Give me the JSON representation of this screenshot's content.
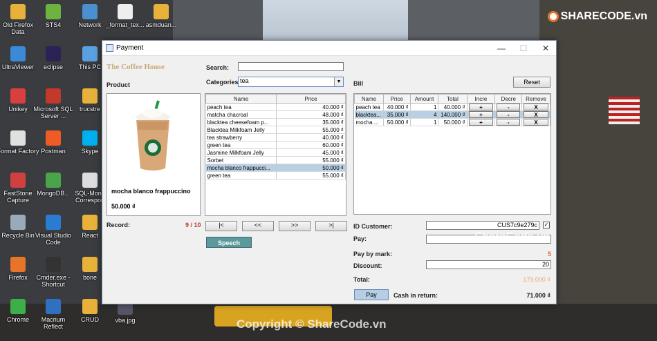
{
  "desktop": {
    "icons_left": [
      {
        "label": "Old Firefox Data",
        "color": "#e8b23a"
      },
      {
        "label": "UltraViewer",
        "color": "#3a8ad8"
      },
      {
        "label": "Unikey",
        "color": "#d84040"
      },
      {
        "label": "Format Factory",
        "color": "#e0e0e0"
      },
      {
        "label": "FastStone Capture",
        "color": "#d04040"
      },
      {
        "label": "Recycle Bin",
        "color": "#9ab"
      },
      {
        "label": "Firefox",
        "color": "#e8742a"
      },
      {
        "label": "Chrome",
        "color": "#3cae4a"
      }
    ],
    "icons_col2": [
      {
        "label": "STS4",
        "color": "#6cb33f"
      },
      {
        "label": "eclipse",
        "color": "#2c2255"
      },
      {
        "label": "Microsoft SQL Server ...",
        "color": "#c0392b"
      },
      {
        "label": "Postman",
        "color": "#ef5b25"
      },
      {
        "label": "MongoDB...",
        "color": "#4aa54a"
      },
      {
        "label": "Visual Studio Code",
        "color": "#2a7cd3"
      },
      {
        "label": "Cmder.exe - Shortcut",
        "color": "#333"
      },
      {
        "label": "Macrium Reflect",
        "color": "#3070c0"
      }
    ],
    "icons_col3": [
      {
        "label": "Network",
        "color": "#4a90d0"
      },
      {
        "label": "This PC",
        "color": "#5aa0e0"
      },
      {
        "label": "trucstre",
        "color": "#e8b23a"
      },
      {
        "label": "Skype",
        "color": "#00aff0"
      },
      {
        "label": "SQL-Mong Correspon",
        "color": "#ddd"
      },
      {
        "label": "React",
        "color": "#e8b23a"
      },
      {
        "label": "bone",
        "color": "#e8b23a"
      },
      {
        "label": "CRUD",
        "color": "#e8b23a"
      }
    ],
    "icons_col4": [
      {
        "label": "_format_tex...",
        "color": "#eee"
      },
      {
        "label": "vba.jpg",
        "color": "#556"
      }
    ],
    "icons_col5": [
      {
        "label": "asmduan...",
        "color": "#e8b23a"
      }
    ],
    "watermark_logo": "SHARECODE.vn",
    "watermark_mid": "ShareCode.vn",
    "watermark_bottom": "Copyright © ShareCode.vn"
  },
  "window": {
    "title": "Payment",
    "minimize": "—",
    "maximize": "☐",
    "close": "✕"
  },
  "app": {
    "shop_name": "The Coffee House",
    "product_label": "Product",
    "search_label": "Search:",
    "search_value": "",
    "categories_label": "Categories:",
    "categories_value": "tea",
    "product_name": "mocha blanco frappuccino",
    "product_price": "50.000 ₫",
    "record_label": "Record:",
    "record_value": "9 / 10",
    "nav": {
      "first": "|<",
      "prev": "<<",
      "next": ">>",
      "last": ">|"
    },
    "speech": "Speech",
    "product_table": {
      "headers": [
        "Name",
        "Price"
      ],
      "rows": [
        [
          "peach tea",
          "40.000 ₫"
        ],
        [
          "matcha chacroal",
          "48.000 ₫"
        ],
        [
          "blacktea cheesefoam p...",
          "35.000 ₫"
        ],
        [
          "Blacktea Milkfoam Jelly",
          "55.000 ₫"
        ],
        [
          "tea strawberry",
          "40.000 ₫"
        ],
        [
          "green tea",
          "60.000 ₫"
        ],
        [
          "Jasmine Milkfoam Jelly",
          "45.000 ₫"
        ],
        [
          "Sorbet",
          "55.000 ₫"
        ],
        [
          "mocha blanco frappucci...",
          "50.000 ₫"
        ],
        [
          "green tea",
          "55.000 ₫"
        ]
      ],
      "selected_index": 8
    },
    "bill_label": "Bill",
    "reset": "Reset",
    "bill_table": {
      "headers": [
        "Name",
        "Price",
        "Amount",
        "Total",
        "Incre",
        "Decre",
        "Remove"
      ],
      "rows": [
        {
          "name": "peach tea",
          "price": "40.000 ₫",
          "amount": "1",
          "total": "40.000 ₫",
          "incre": "+",
          "decre": "-",
          "remove": "X"
        },
        {
          "name": "blacktea...",
          "price": "35.000 ₫",
          "amount": "4",
          "total": "140.000 ₫",
          "incre": "+",
          "decre": "-",
          "remove": "X"
        },
        {
          "name": "mocha ...",
          "price": "50.000 ₫",
          "amount": "1",
          "total": "50.000 ₫",
          "incre": "+",
          "decre": "-",
          "remove": "X"
        }
      ],
      "selected_index": 1
    },
    "id_customer_label": "ID Customer:",
    "id_customer_value": "CUS7c9e279c",
    "pay_label": "Pay:",
    "pay_value": "",
    "pay_by_mark_label": "Pay by mark:",
    "pay_by_mark_value": "5",
    "discount_label": "Discount:",
    "discount_value": "20",
    "total_label": "Total:",
    "total_value": "179.000 ₫",
    "pay_button": "Pay",
    "cash_return_label": "Cash in return:",
    "cash_return_value": "71.000 ₫"
  }
}
